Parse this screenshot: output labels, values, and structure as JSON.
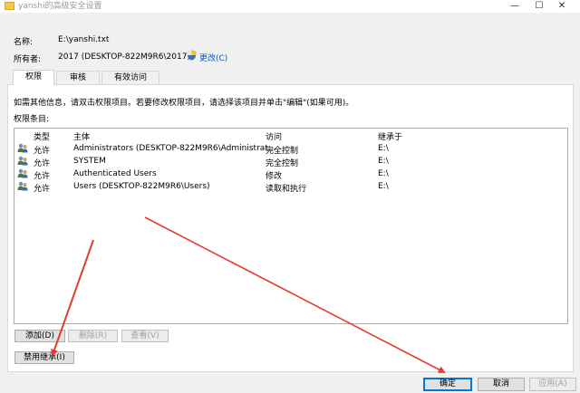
{
  "window": {
    "title": "yanshi的高级安全设置",
    "controls": {
      "minimize": "—",
      "maximize": "☐",
      "close": "✕"
    }
  },
  "details": {
    "name_label": "名称:",
    "name_value": "E:\\yanshi.txt",
    "owner_label": "所有者:",
    "owner_value": "2017 (DESKTOP-822M9R6\\2017)",
    "change_link": "更改(C)"
  },
  "tabs": [
    {
      "label": "权限",
      "active": true
    },
    {
      "label": "审核",
      "active": false
    },
    {
      "label": "有效访问",
      "active": false
    }
  ],
  "panel": {
    "info_text": "如需其他信息，请双击权限项目。若要修改权限项目，请选择该项目并单击\"编辑\"(如果可用)。",
    "entries_label": "权限条目:"
  },
  "permissions_table": {
    "columns": [
      "类型",
      "主体",
      "访问",
      "继承于"
    ],
    "rows": [
      {
        "type": "允许",
        "principal": "Administrators (DESKTOP-822M9R6\\Administrat...",
        "access": "完全控制",
        "inherited_from": "E:\\"
      },
      {
        "type": "允许",
        "principal": "SYSTEM",
        "access": "完全控制",
        "inherited_from": "E:\\"
      },
      {
        "type": "允许",
        "principal": "Authenticated Users",
        "access": "修改",
        "inherited_from": "E:\\"
      },
      {
        "type": "允许",
        "principal": "Users (DESKTOP-822M9R6\\Users)",
        "access": "读取和执行",
        "inherited_from": "E:\\"
      }
    ]
  },
  "buttons": {
    "add": "添加(D)",
    "remove": "删除(R)",
    "view": "查看(V)",
    "disable_inheritance": "禁用继承(I)",
    "ok": "确定",
    "cancel": "取消",
    "apply": "应用(A)"
  },
  "colors": {
    "link": "#0b59b5",
    "annotation_arrow": "#e53a2e",
    "primary_border": "#0078d7"
  },
  "icons": [
    "folder-icon",
    "shield-icon",
    "user-group-icon"
  ]
}
